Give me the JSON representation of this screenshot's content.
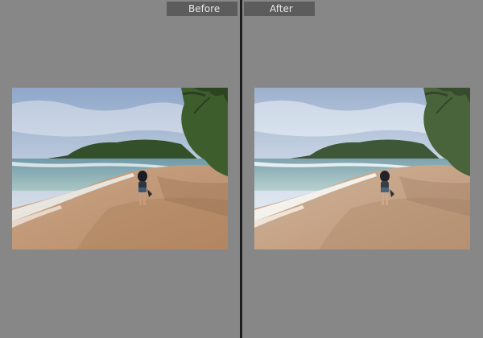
{
  "panes": [
    {
      "label": "Before"
    },
    {
      "label": "After"
    }
  ],
  "colors": {
    "background": "#878787",
    "divider": "#1e1e1e",
    "label_bg": "#5c5c5c",
    "label_text": "#e6e6e6"
  },
  "icons": [
    "photo-before",
    "photo-after"
  ]
}
